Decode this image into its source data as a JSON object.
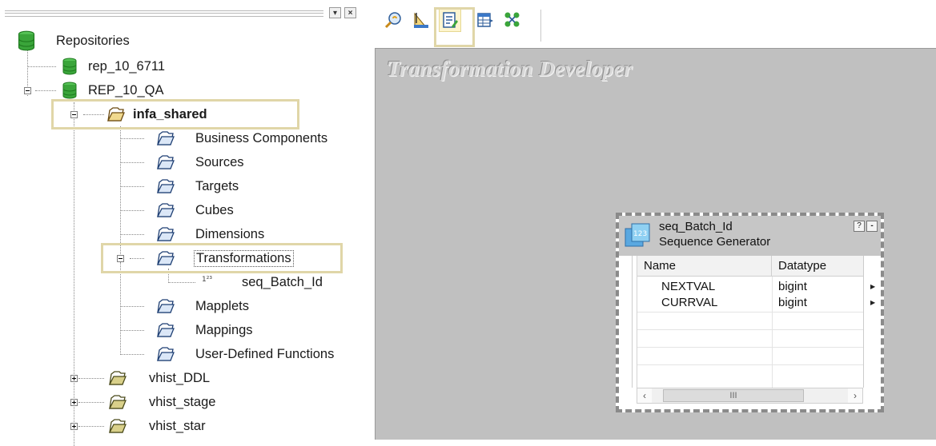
{
  "navigator": {
    "tree": {
      "root": "Repositories",
      "repo1": "rep_10_6711",
      "repo2": "REP_10_QA",
      "folder": "infa_shared",
      "children": [
        "Business Components",
        "Sources",
        "Targets",
        "Cubes",
        "Dimensions",
        "Transformations"
      ],
      "transformation_item": "seq_Batch_Id",
      "more_children": [
        "Mapplets",
        "Mappings",
        "User-Defined Functions"
      ],
      "other_folders": [
        "vhist_DDL",
        "vhist_stage",
        "vhist_star"
      ]
    },
    "icons": {
      "repository": "database-icon",
      "folder": "folder-icon",
      "sequence": "sequence-icon"
    }
  },
  "toolbar": {
    "buttons": [
      "source-analyzer-icon",
      "target-designer-icon",
      "transformation-developer-icon",
      "mapplet-designer-icon",
      "mapping-designer-icon"
    ],
    "active": "transformation-developer-icon"
  },
  "workspace": {
    "title": "Transformation Developer",
    "transformation": {
      "name": "seq_Batch_Id",
      "type": "Sequence Generator",
      "columns": {
        "name": "Name",
        "datatype": "Datatype"
      },
      "ports": [
        {
          "name": "NEXTVAL",
          "datatype": "bigint"
        },
        {
          "name": "CURRVAL",
          "datatype": "bigint"
        }
      ],
      "scroll_thumb": "III",
      "help_label": "?",
      "min_label": "-"
    }
  },
  "colors": {
    "highlight": "#e0d6a8",
    "canvas": "#c0c0c0",
    "db_green": "#3aa53a",
    "folder_blue": "#3b6fb6"
  }
}
